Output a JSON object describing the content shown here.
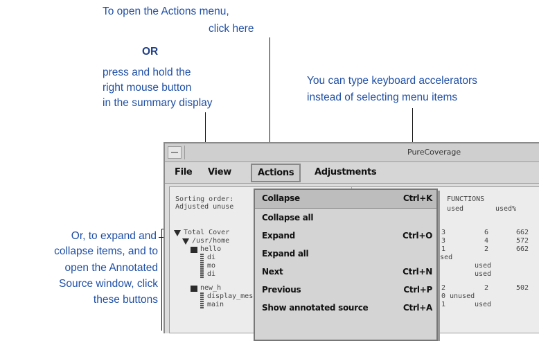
{
  "annotations": {
    "actions_line1": "To open the Actions menu,",
    "actions_line2": "click here",
    "or": "OR",
    "right_mouse_line1": "press and hold the",
    "right_mouse_line2": "right mouse button",
    "right_mouse_line3": "in the summary display",
    "accel_line1": "You can type keyboard accelerators",
    "accel_line2": "instead of selecting menu items",
    "expand_line1": "Or, to expand and",
    "expand_line2": "collapse items, and to",
    "expand_line3": "open the Annotated",
    "expand_line4": "Source window, click",
    "expand_line5": "these buttons"
  },
  "window": {
    "title": "PureCoverage"
  },
  "menubar": {
    "file": "File",
    "view": "View",
    "actions": "Actions",
    "adjustments": "Adjustments"
  },
  "actions_menu": [
    {
      "label": "Collapse",
      "accel": "Ctrl+K"
    },
    {
      "label": "Collapse all",
      "accel": ""
    },
    {
      "label": "Expand",
      "accel": "Ctrl+O"
    },
    {
      "label": "Expand all",
      "accel": ""
    },
    {
      "label": "Next",
      "accel": "Ctrl+N"
    },
    {
      "label": "Previous",
      "accel": "Ctrl+P"
    },
    {
      "label": "Show annotated source",
      "accel": "Ctrl+A"
    }
  ],
  "summary": {
    "sorting": "Sorting order:",
    "adjusted": "Adjusted unuse",
    "functions_header": "FUNCTIONS",
    "col_used": "used",
    "col_used_pct": "used%",
    "rows": [
      {
        "label": "Total Cover",
        "a": "3",
        "b": "6",
        "c": "662"
      },
      {
        "label": "/usr/home",
        "a": "3",
        "b": "4",
        "c": "572"
      },
      {
        "label": "hello",
        "a": "1",
        "b": "2",
        "c": "662"
      },
      {
        "label": "di",
        "a": "",
        "b": "",
        "c": ""
      },
      {
        "label": "mo",
        "a": "",
        "b": "used",
        "c": ""
      },
      {
        "label": "di",
        "a": "",
        "b": "used",
        "c": ""
      },
      {
        "label": "new_h",
        "a": "2",
        "b": "2",
        "c": "502"
      },
      {
        "label": "display_message",
        "a": "0",
        "b": "",
        "c": ""
      },
      {
        "label": "main",
        "a": "1",
        "b": "used",
        "c": ""
      }
    ],
    "unused": "unused",
    "unused2": "unused"
  }
}
